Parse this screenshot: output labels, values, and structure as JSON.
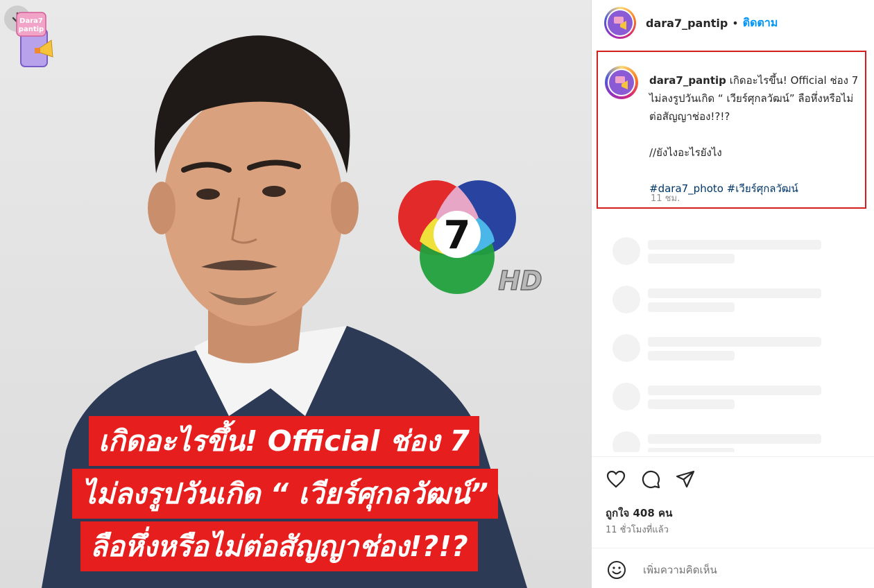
{
  "media": {
    "caption_lines": [
      "เกิดอะไรขึ้น! Official ช่อง 7",
      "ไม่ลงรูปวันเกิด “ เวียร์ศุกลวัฒน์”",
      "ลือหึ่งหรือไม่ต่อสัญญาช่อง!?!?"
    ],
    "brand_logo_text": [
      "Dara7",
      "pantip"
    ],
    "channel_logo_text": "7",
    "channel_logo_suffix": "HD"
  },
  "header": {
    "username": "dara7_pantip",
    "separator": "•",
    "follow_label": "ติดตาม"
  },
  "post": {
    "username": "dara7_pantip",
    "text_line1": "เกิดอะไรขึ้น! Official ช่อง 7 ไม่ลงรูปวันเกิด “ เวียร์ศุกลวัฒน์” ลือหึ่งหรือไม่ต่อสัญญาช่อง!?!?",
    "text_line2": "//ยังไงอะไรยังไง",
    "hashtags": [
      "#dara7_photo",
      "#เวียร์ศุกลวัฒน์"
    ],
    "time": "11 ชม."
  },
  "actions": {
    "like_icon": "heart-icon",
    "comment_icon": "comment-icon",
    "share_icon": "share-icon"
  },
  "likes_text": "ถูกใจ 408 คน",
  "timestamp_text": "11 ชั่วโมงที่แล้ว",
  "comment": {
    "emoji_icon": "smiley-icon",
    "placeholder": "เพิ่มความคิดเห็น"
  },
  "colors": {
    "follow": "#0095f6",
    "hashtag": "#00376b",
    "caption_bg": "#e61e1e",
    "highlight_border": "#d41f1f"
  }
}
